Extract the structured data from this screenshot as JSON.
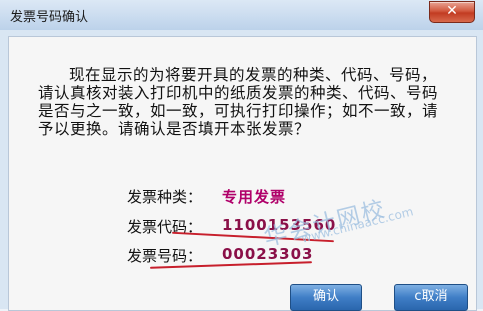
{
  "window": {
    "title": "发票号码确认",
    "close_label": "✕"
  },
  "message": "现在显示的为将要开具的发票的种类、代码、号码，请认真核对装入打印机中的纸质发票的种类、代码、号码是否与之一致，如一致，可执行打印操作；如不一致，请予以更换。请确认是否填开本张发票？",
  "invoice": {
    "type_label": "发票种类：",
    "type_value": "专用发票",
    "code_label": "发票代码：",
    "code_value": "1100153560",
    "number_label": "发票号码：",
    "number_value": "00023303"
  },
  "buttons": {
    "confirm": "确认",
    "cancel": "c取消"
  },
  "watermark": {
    "text": "华会计网校",
    "url": "www.chinaacc.com"
  },
  "colors": {
    "value_text": "#8a1048",
    "annotation_underline": "#c71f2c",
    "close_button": "#c23b22"
  }
}
